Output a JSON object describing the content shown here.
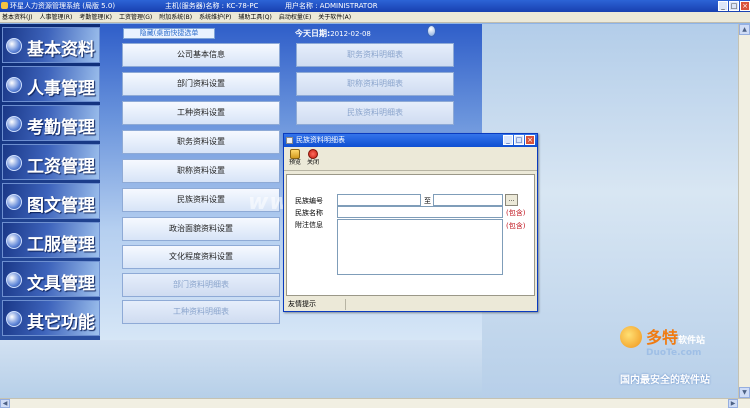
{
  "titlebar": {
    "app_title": "环星人力资源管理系统 (局版 5.0)",
    "host": "主机(服务器)名称 : KC-78-PC",
    "user": "用户名称 : ADMINISTRATOR",
    "minimize": "_",
    "maximize": "□",
    "close": "×"
  },
  "menu": [
    "基本资料(J)",
    "人事管理(R)",
    "考勤管理(K)",
    "工资管理(G)",
    "附加系统(B)",
    "系统维护(P)",
    "辅助工具(Q)",
    "启动权量(E)",
    "关于软件(A)"
  ],
  "sidebar": [
    {
      "label": "基本资料"
    },
    {
      "label": "人事管理"
    },
    {
      "label": "考勤管理"
    },
    {
      "label": "工资管理"
    },
    {
      "label": "图文管理"
    },
    {
      "label": "工服管理"
    },
    {
      "label": "文具管理"
    },
    {
      "label": "其它功能"
    }
  ],
  "shortcut_tag": "隐藏(桌面快捷选单",
  "today": {
    "label": "今天日期:",
    "date": "2012-02-08"
  },
  "left_buttons": [
    {
      "label": "公司基本信息"
    },
    {
      "label": "部门资料设置"
    },
    {
      "label": "工种资料设置"
    },
    {
      "label": "职务资料设置"
    },
    {
      "label": "职称资料设置"
    },
    {
      "label": "民族资料设置"
    },
    {
      "label": "政治面貌资料设置"
    },
    {
      "label": "文化程度资料设置"
    },
    {
      "label": "部门资料明细表"
    },
    {
      "label": "工种资料明细表"
    }
  ],
  "right_buttons": [
    {
      "label": "职务资料明细表"
    },
    {
      "label": "职称资料明细表"
    },
    {
      "label": "民族资料明细表"
    }
  ],
  "dialog": {
    "title": "民族资料明细表",
    "toolbar": {
      "preview": "预览",
      "close": "关闭"
    },
    "fields": {
      "code_label": "民族编号",
      "to_label": "至",
      "name_label": "民族名称",
      "note_label": "附注信息",
      "contains1": "(包含)",
      "contains2": "(包含)",
      "browse": "..."
    },
    "status": "友情提示"
  },
  "watermark": {
    "center": "www.DuoTe.com",
    "brand": "多特",
    "brand_sub": "软件站",
    "domain": "DuoTe.com",
    "slogan": "国内最安全的软件站"
  }
}
